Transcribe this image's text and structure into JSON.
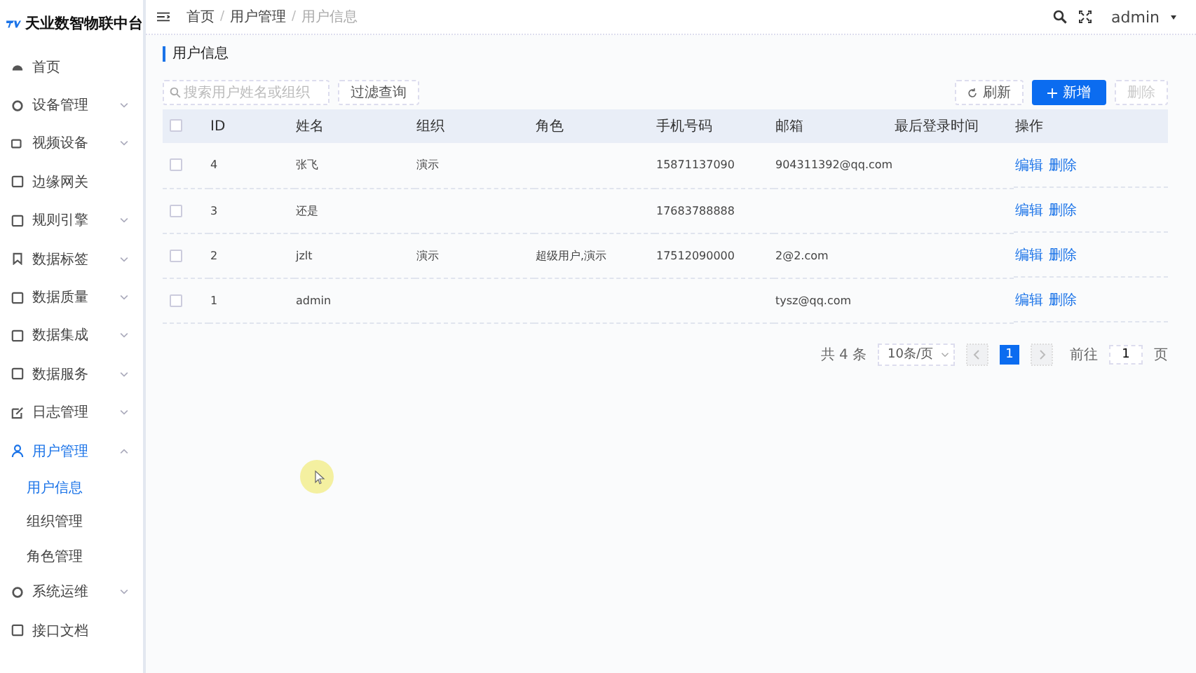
{
  "brand": {
    "name": "天业数智物联中台"
  },
  "sidebar": {
    "items": [
      {
        "label": "首页",
        "selected": false
      },
      {
        "label": "设备管理",
        "expanded": false,
        "selected": false
      },
      {
        "label": "视频设备",
        "expanded": false,
        "selected": false
      },
      {
        "label": "边缘网关",
        "selected": false
      },
      {
        "label": "规则引擎",
        "expanded": false,
        "selected": false
      },
      {
        "label": "数据标签",
        "expanded": false,
        "selected": false
      },
      {
        "label": "数据质量",
        "expanded": false,
        "selected": false
      },
      {
        "label": "数据集成",
        "expanded": false,
        "selected": false
      },
      {
        "label": "数据服务",
        "expanded": false,
        "selected": false
      },
      {
        "label": "日志管理",
        "expanded": false,
        "selected": false
      },
      {
        "label": "用户管理",
        "expanded": true,
        "selected": true,
        "children": [
          {
            "label": "用户信息",
            "selected": true
          },
          {
            "label": "组织管理",
            "selected": false
          },
          {
            "label": "角色管理",
            "selected": false
          }
        ]
      },
      {
        "label": "系统运维",
        "expanded": false,
        "selected": false
      },
      {
        "label": "接口文档",
        "selected": false
      }
    ]
  },
  "header": {
    "breadcrumb": [
      "首页",
      "用户管理",
      "用户信息"
    ],
    "separator": "/",
    "user": "admin"
  },
  "page_title": "用户信息",
  "search": {
    "placeholder": "搜索用户姓名或组织"
  },
  "filter_button": "过滤查询",
  "actions": [
    {
      "label": "刷新",
      "kind": "refresh",
      "disabled": false
    },
    {
      "label": "新增",
      "kind": "primary",
      "disabled": false
    },
    {
      "label": "删除",
      "kind": "plain",
      "disabled": true
    }
  ],
  "table": {
    "all_checked": false,
    "columns": [
      "ID",
      "姓名",
      "组织",
      "角色",
      "手机号码",
      "邮箱",
      "最后登录时间",
      "操作"
    ],
    "rows": [
      {
        "checked": false,
        "cells": [
          "4",
          "张飞",
          "演示",
          "",
          "15871137090",
          "904311392@qq.com",
          ""
        ],
        "actions": [
          "编辑",
          "删除"
        ]
      },
      {
        "checked": false,
        "cells": [
          "3",
          "还是",
          "",
          "",
          "17683788888",
          "",
          ""
        ],
        "actions": [
          "编辑",
          "删除"
        ]
      },
      {
        "checked": false,
        "cells": [
          "2",
          "jzlt",
          "演示",
          "超级用户,演示",
          "17512090000",
          "2@2.com",
          ""
        ],
        "actions": [
          "编辑",
          "删除"
        ]
      },
      {
        "checked": false,
        "cells": [
          "1",
          "admin",
          "",
          "",
          "",
          "tysz@qq.com",
          ""
        ],
        "actions": [
          "编辑",
          "删除"
        ]
      }
    ]
  },
  "pagination": {
    "total": "共 4 条",
    "page_size": "10条/页",
    "pages": [
      {
        "label": "1",
        "selected": true
      }
    ],
    "goto_label": "前往",
    "goto_value": "1",
    "goto_suffix": "页"
  }
}
